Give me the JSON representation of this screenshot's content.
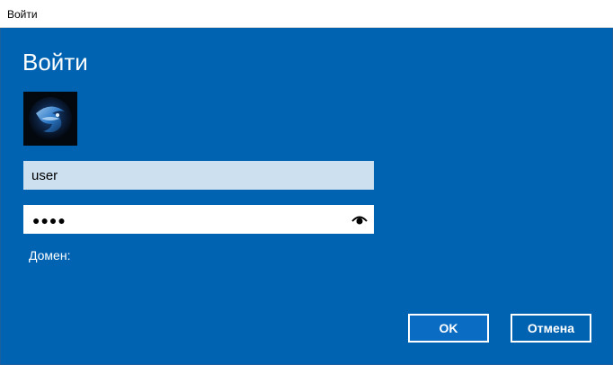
{
  "window": {
    "title": "Войти"
  },
  "dialog": {
    "heading": "Войти",
    "avatar_icon": "user-avatar-image",
    "username_value": "user",
    "password_masked": "●●●●",
    "reveal_icon": "eye-icon",
    "domain_label": "Домен:",
    "ok_label": "OK",
    "cancel_label": "Отмена"
  },
  "colors": {
    "background": "#0063b1",
    "titlebar": "#ffffff",
    "username_field": "#cce0f0",
    "password_field": "#ffffff",
    "text_light": "#ffffff"
  }
}
